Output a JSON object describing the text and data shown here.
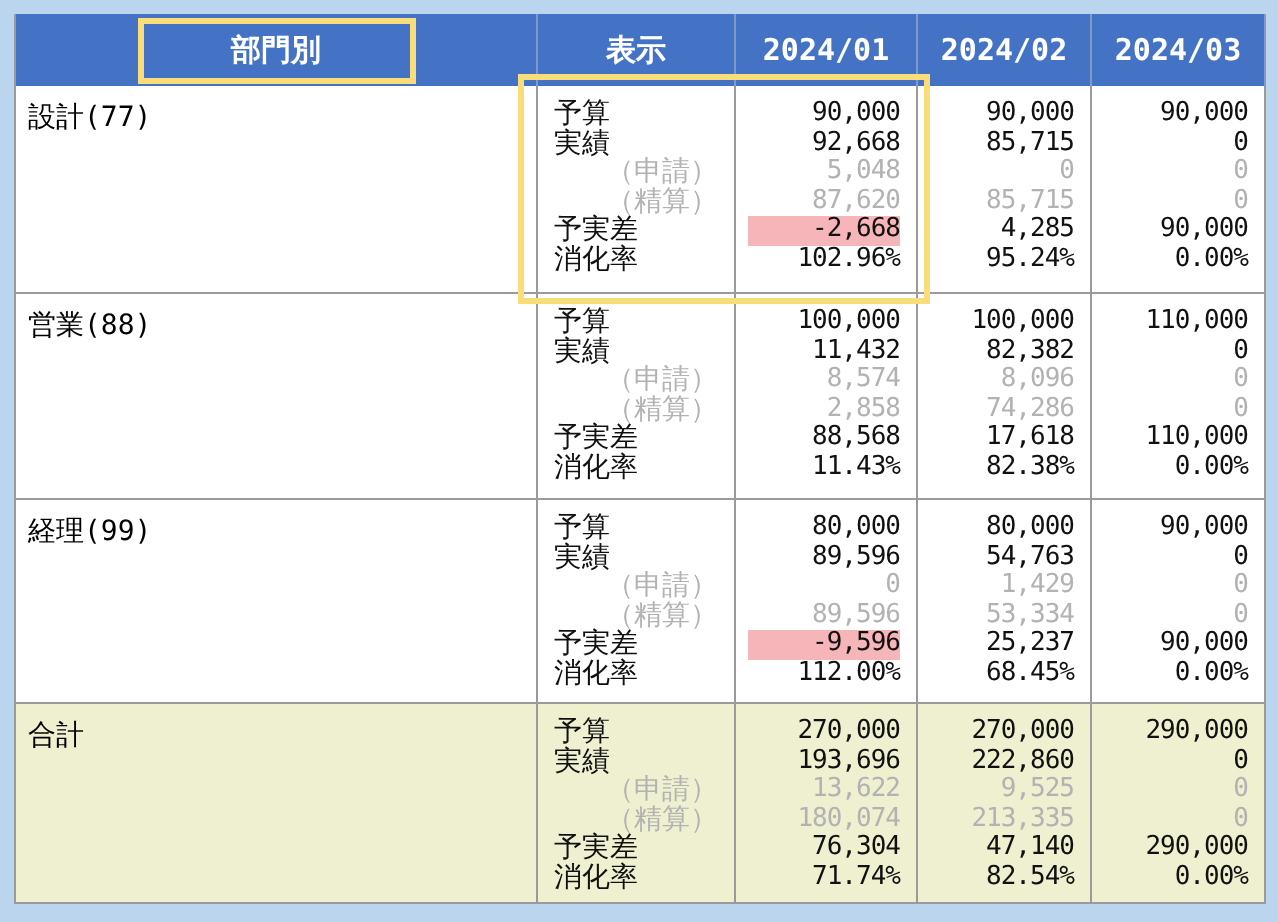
{
  "table": {
    "columns": [
      {
        "label": "部門別",
        "highlighted": true
      },
      {
        "label": "表示",
        "highlighted": false
      },
      {
        "label": "2024/01",
        "highlighted": false
      },
      {
        "label": "2024/02",
        "highlighted": false
      },
      {
        "label": "2024/03",
        "highlighted": false
      }
    ],
    "rows": [
      {
        "department": "設計(77)",
        "kind": "dept",
        "highlighted": true,
        "lines": [
          {
            "label": "予算",
            "kind": "main",
            "values": [
              "90,000",
              "90,000",
              "90,000"
            ],
            "alert": [
              false,
              false,
              false
            ]
          },
          {
            "label": "実績",
            "kind": "main",
            "values": [
              "92,668",
              "85,715",
              "0"
            ],
            "alert": [
              false,
              false,
              false
            ]
          },
          {
            "label": "（申請）",
            "kind": "sub",
            "values": [
              "5,048",
              "0",
              "0"
            ],
            "alert": [
              false,
              false,
              false
            ]
          },
          {
            "label": "（精算）",
            "kind": "sub",
            "values": [
              "87,620",
              "85,715",
              "0"
            ],
            "alert": [
              false,
              false,
              false
            ]
          },
          {
            "label": "予実差",
            "kind": "main",
            "values": [
              "-2,668",
              "4,285",
              "90,000"
            ],
            "alert": [
              true,
              false,
              false
            ]
          },
          {
            "label": "消化率",
            "kind": "main",
            "values": [
              "102.96%",
              "95.24%",
              "0.00%"
            ],
            "alert": [
              false,
              false,
              false
            ]
          }
        ]
      },
      {
        "department": "営業(88)",
        "kind": "dept",
        "highlighted": false,
        "lines": [
          {
            "label": "予算",
            "kind": "main",
            "values": [
              "100,000",
              "100,000",
              "110,000"
            ],
            "alert": [
              false,
              false,
              false
            ]
          },
          {
            "label": "実績",
            "kind": "main",
            "values": [
              "11,432",
              "82,382",
              "0"
            ],
            "alert": [
              false,
              false,
              false
            ]
          },
          {
            "label": "（申請）",
            "kind": "sub",
            "values": [
              "8,574",
              "8,096",
              "0"
            ],
            "alert": [
              false,
              false,
              false
            ]
          },
          {
            "label": "（精算）",
            "kind": "sub",
            "values": [
              "2,858",
              "74,286",
              "0"
            ],
            "alert": [
              false,
              false,
              false
            ]
          },
          {
            "label": "予実差",
            "kind": "main",
            "values": [
              "88,568",
              "17,618",
              "110,000"
            ],
            "alert": [
              false,
              false,
              false
            ]
          },
          {
            "label": "消化率",
            "kind": "main",
            "values": [
              "11.43%",
              "82.38%",
              "0.00%"
            ],
            "alert": [
              false,
              false,
              false
            ]
          }
        ]
      },
      {
        "department": "経理(99)",
        "kind": "dept",
        "highlighted": false,
        "lines": [
          {
            "label": "予算",
            "kind": "main",
            "values": [
              "80,000",
              "80,000",
              "90,000"
            ],
            "alert": [
              false,
              false,
              false
            ]
          },
          {
            "label": "実績",
            "kind": "main",
            "values": [
              "89,596",
              "54,763",
              "0"
            ],
            "alert": [
              false,
              false,
              false
            ]
          },
          {
            "label": "（申請）",
            "kind": "sub",
            "values": [
              "0",
              "1,429",
              "0"
            ],
            "alert": [
              false,
              false,
              false
            ]
          },
          {
            "label": "（精算）",
            "kind": "sub",
            "values": [
              "89,596",
              "53,334",
              "0"
            ],
            "alert": [
              false,
              false,
              false
            ]
          },
          {
            "label": "予実差",
            "kind": "main",
            "values": [
              "-9,596",
              "25,237",
              "90,000"
            ],
            "alert": [
              true,
              false,
              false
            ]
          },
          {
            "label": "消化率",
            "kind": "main",
            "values": [
              "112.00%",
              "68.45%",
              "0.00%"
            ],
            "alert": [
              false,
              false,
              false
            ]
          }
        ]
      },
      {
        "department": "合計",
        "kind": "total",
        "highlighted": false,
        "lines": [
          {
            "label": "予算",
            "kind": "main",
            "values": [
              "270,000",
              "270,000",
              "290,000"
            ],
            "alert": [
              false,
              false,
              false
            ]
          },
          {
            "label": "実績",
            "kind": "main",
            "values": [
              "193,696",
              "222,860",
              "0"
            ],
            "alert": [
              false,
              false,
              false
            ]
          },
          {
            "label": "（申請）",
            "kind": "sub",
            "values": [
              "13,622",
              "9,525",
              "0"
            ],
            "alert": [
              false,
              false,
              false
            ]
          },
          {
            "label": "（精算）",
            "kind": "sub",
            "values": [
              "180,074",
              "213,335",
              "0"
            ],
            "alert": [
              false,
              false,
              false
            ]
          },
          {
            "label": "予実差",
            "kind": "main",
            "values": [
              "76,304",
              "47,140",
              "290,000"
            ],
            "alert": [
              false,
              false,
              false
            ]
          },
          {
            "label": "消化率",
            "kind": "main",
            "values": [
              "71.74%",
              "82.54%",
              "0.00%"
            ],
            "alert": [
              false,
              false,
              false
            ]
          }
        ]
      }
    ]
  }
}
